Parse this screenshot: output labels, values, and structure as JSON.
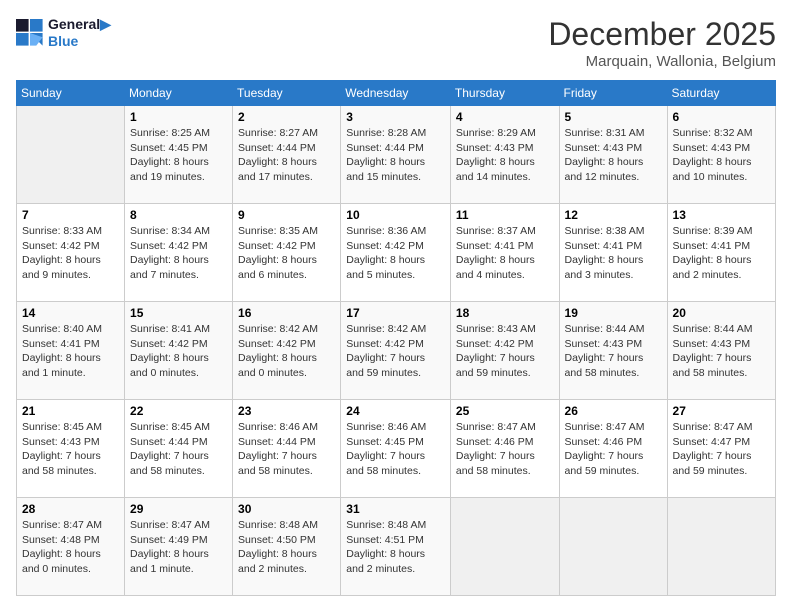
{
  "header": {
    "logo_line1": "General",
    "logo_line2": "Blue",
    "month": "December 2025",
    "location": "Marquain, Wallonia, Belgium"
  },
  "days_of_week": [
    "Sunday",
    "Monday",
    "Tuesday",
    "Wednesday",
    "Thursday",
    "Friday",
    "Saturday"
  ],
  "weeks": [
    [
      {
        "day": "",
        "info": ""
      },
      {
        "day": "1",
        "info": "Sunrise: 8:25 AM\nSunset: 4:45 PM\nDaylight: 8 hours\nand 19 minutes."
      },
      {
        "day": "2",
        "info": "Sunrise: 8:27 AM\nSunset: 4:44 PM\nDaylight: 8 hours\nand 17 minutes."
      },
      {
        "day": "3",
        "info": "Sunrise: 8:28 AM\nSunset: 4:44 PM\nDaylight: 8 hours\nand 15 minutes."
      },
      {
        "day": "4",
        "info": "Sunrise: 8:29 AM\nSunset: 4:43 PM\nDaylight: 8 hours\nand 14 minutes."
      },
      {
        "day": "5",
        "info": "Sunrise: 8:31 AM\nSunset: 4:43 PM\nDaylight: 8 hours\nand 12 minutes."
      },
      {
        "day": "6",
        "info": "Sunrise: 8:32 AM\nSunset: 4:43 PM\nDaylight: 8 hours\nand 10 minutes."
      }
    ],
    [
      {
        "day": "7",
        "info": "Sunrise: 8:33 AM\nSunset: 4:42 PM\nDaylight: 8 hours\nand 9 minutes."
      },
      {
        "day": "8",
        "info": "Sunrise: 8:34 AM\nSunset: 4:42 PM\nDaylight: 8 hours\nand 7 minutes."
      },
      {
        "day": "9",
        "info": "Sunrise: 8:35 AM\nSunset: 4:42 PM\nDaylight: 8 hours\nand 6 minutes."
      },
      {
        "day": "10",
        "info": "Sunrise: 8:36 AM\nSunset: 4:42 PM\nDaylight: 8 hours\nand 5 minutes."
      },
      {
        "day": "11",
        "info": "Sunrise: 8:37 AM\nSunset: 4:41 PM\nDaylight: 8 hours\nand 4 minutes."
      },
      {
        "day": "12",
        "info": "Sunrise: 8:38 AM\nSunset: 4:41 PM\nDaylight: 8 hours\nand 3 minutes."
      },
      {
        "day": "13",
        "info": "Sunrise: 8:39 AM\nSunset: 4:41 PM\nDaylight: 8 hours\nand 2 minutes."
      }
    ],
    [
      {
        "day": "14",
        "info": "Sunrise: 8:40 AM\nSunset: 4:41 PM\nDaylight: 8 hours\nand 1 minute."
      },
      {
        "day": "15",
        "info": "Sunrise: 8:41 AM\nSunset: 4:42 PM\nDaylight: 8 hours\nand 0 minutes."
      },
      {
        "day": "16",
        "info": "Sunrise: 8:42 AM\nSunset: 4:42 PM\nDaylight: 8 hours\nand 0 minutes."
      },
      {
        "day": "17",
        "info": "Sunrise: 8:42 AM\nSunset: 4:42 PM\nDaylight: 7 hours\nand 59 minutes."
      },
      {
        "day": "18",
        "info": "Sunrise: 8:43 AM\nSunset: 4:42 PM\nDaylight: 7 hours\nand 59 minutes."
      },
      {
        "day": "19",
        "info": "Sunrise: 8:44 AM\nSunset: 4:43 PM\nDaylight: 7 hours\nand 58 minutes."
      },
      {
        "day": "20",
        "info": "Sunrise: 8:44 AM\nSunset: 4:43 PM\nDaylight: 7 hours\nand 58 minutes."
      }
    ],
    [
      {
        "day": "21",
        "info": "Sunrise: 8:45 AM\nSunset: 4:43 PM\nDaylight: 7 hours\nand 58 minutes."
      },
      {
        "day": "22",
        "info": "Sunrise: 8:45 AM\nSunset: 4:44 PM\nDaylight: 7 hours\nand 58 minutes."
      },
      {
        "day": "23",
        "info": "Sunrise: 8:46 AM\nSunset: 4:44 PM\nDaylight: 7 hours\nand 58 minutes."
      },
      {
        "day": "24",
        "info": "Sunrise: 8:46 AM\nSunset: 4:45 PM\nDaylight: 7 hours\nand 58 minutes."
      },
      {
        "day": "25",
        "info": "Sunrise: 8:47 AM\nSunset: 4:46 PM\nDaylight: 7 hours\nand 58 minutes."
      },
      {
        "day": "26",
        "info": "Sunrise: 8:47 AM\nSunset: 4:46 PM\nDaylight: 7 hours\nand 59 minutes."
      },
      {
        "day": "27",
        "info": "Sunrise: 8:47 AM\nSunset: 4:47 PM\nDaylight: 7 hours\nand 59 minutes."
      }
    ],
    [
      {
        "day": "28",
        "info": "Sunrise: 8:47 AM\nSunset: 4:48 PM\nDaylight: 8 hours\nand 0 minutes."
      },
      {
        "day": "29",
        "info": "Sunrise: 8:47 AM\nSunset: 4:49 PM\nDaylight: 8 hours\nand 1 minute."
      },
      {
        "day": "30",
        "info": "Sunrise: 8:48 AM\nSunset: 4:50 PM\nDaylight: 8 hours\nand 2 minutes."
      },
      {
        "day": "31",
        "info": "Sunrise: 8:48 AM\nSunset: 4:51 PM\nDaylight: 8 hours\nand 2 minutes."
      },
      {
        "day": "",
        "info": ""
      },
      {
        "day": "",
        "info": ""
      },
      {
        "day": "",
        "info": ""
      }
    ]
  ]
}
